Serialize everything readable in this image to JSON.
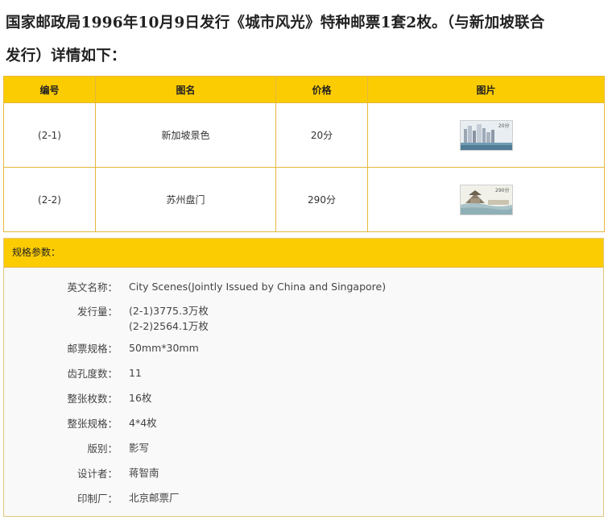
{
  "intro": {
    "line1": "国家邮政局1996年10月9日发行《城市风光》特种邮票1套2枚。（与新加坡联合",
    "line2": "发行）详情如下："
  },
  "table": {
    "headers": [
      "编号",
      "图名",
      "价格",
      "图片"
    ],
    "rows": [
      {
        "code": "(2-1)",
        "name": "新加坡景色",
        "price": "20分",
        "stamp_value": "20分",
        "stamp_icon": "singapore-skyline-stamp-icon"
      },
      {
        "code": "(2-2)",
        "name": "苏州盘门",
        "price": "290分",
        "stamp_value": "290分",
        "stamp_icon": "suzhou-pan-gate-stamp-icon"
      }
    ]
  },
  "specs": {
    "title": "规格参数：",
    "items": [
      {
        "label": "英文名称：",
        "value": [
          "City Scenes(Jointly Issued by China and Singapore)"
        ]
      },
      {
        "label": "发行量：",
        "value": [
          "(2-1)3775.3万枚",
          "(2-2)2564.1万枚"
        ]
      },
      {
        "label": "邮票规格：",
        "value": [
          "50mm*30mm"
        ]
      },
      {
        "label": "齿孔度数：",
        "value": [
          "11"
        ]
      },
      {
        "label": "整张枚数：",
        "value": [
          "16枚"
        ]
      },
      {
        "label": "整张规格：",
        "value": [
          "4*4枚"
        ]
      },
      {
        "label": "版别：",
        "value": [
          "影写"
        ]
      },
      {
        "label": "设计者：",
        "value": [
          "蒋智南"
        ]
      },
      {
        "label": "印制厂：",
        "value": [
          "北京邮票厂"
        ]
      }
    ]
  },
  "colors": {
    "accent": "#fccc02",
    "border": "#e6b73c",
    "panel": "#f9f9f9"
  }
}
